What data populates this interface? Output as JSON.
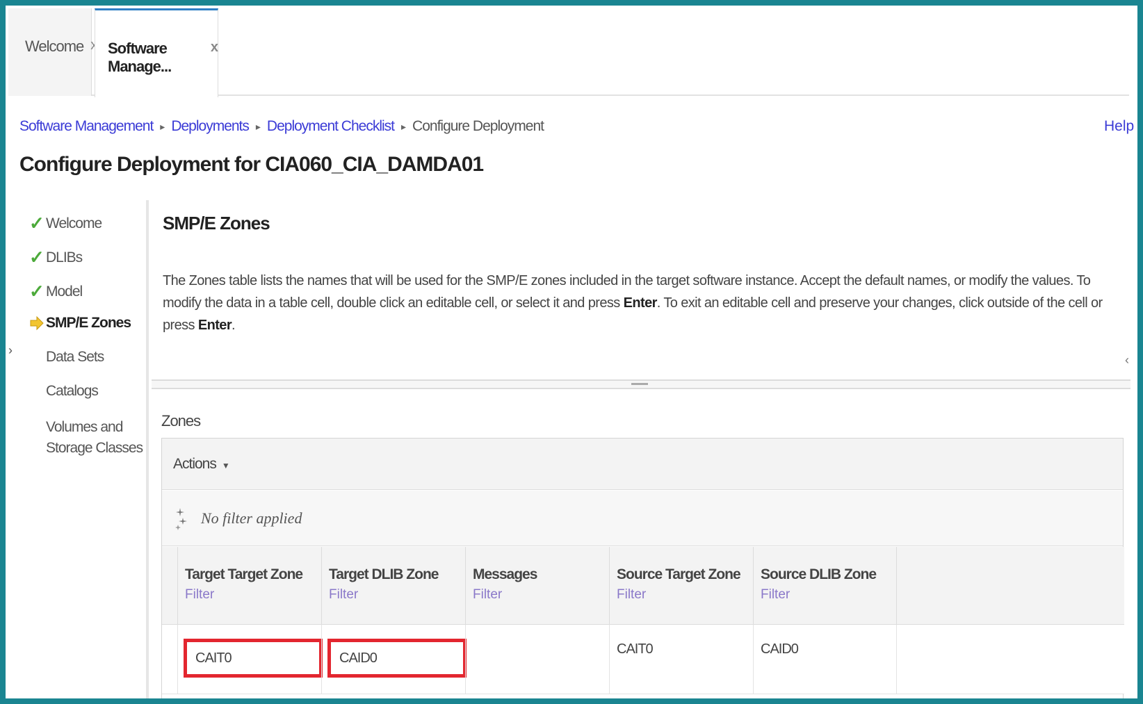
{
  "tabs": [
    {
      "label": "Welcome",
      "close": "x"
    },
    {
      "label": "Software Manage...",
      "close": "x"
    }
  ],
  "breadcrumb": {
    "items": [
      "Software Management",
      "Deployments",
      "Deployment Checklist"
    ],
    "current": "Configure Deployment",
    "separator": "▸"
  },
  "help_label": "Help",
  "page_title": "Configure Deployment for CIA060_CIA_DAMDA01",
  "sidebar": {
    "steps": [
      {
        "label": "Welcome",
        "status": "done"
      },
      {
        "label": "DLIBs",
        "status": "done"
      },
      {
        "label": "Model",
        "status": "done"
      },
      {
        "label": "SMP/E Zones",
        "status": "current"
      },
      {
        "label": "Data Sets",
        "status": "pending"
      },
      {
        "label": "Catalogs",
        "status": "pending"
      },
      {
        "label": "Volumes and Storage Classes",
        "status": "pending"
      }
    ],
    "check_glyph": "✓"
  },
  "main": {
    "section_title": "SMP/E Zones",
    "description_part1": "The Zones table lists the names that will be used for the SMP/E zones included in the target software instance.  Accept the default names, or modify the values. To modify the data in a table cell, double click an editable cell, or select it and press ",
    "description_enter1": "Enter",
    "description_part2": ".  To exit an editable cell and preserve your changes, click outside of the cell or press ",
    "description_enter2": "Enter",
    "description_part3": ".",
    "zones_label": "Zones",
    "actions_label": "Actions",
    "actions_caret": "▼",
    "filter_status": "No filter applied",
    "columns": [
      {
        "label": "Target Target Zone",
        "filter": "Filter"
      },
      {
        "label": "Target DLIB Zone",
        "filter": "Filter"
      },
      {
        "label": "Messages",
        "filter": "Filter"
      },
      {
        "label": "Source Target Zone",
        "filter": "Filter"
      },
      {
        "label": "Source DLIB Zone",
        "filter": "Filter"
      }
    ],
    "rows": [
      {
        "target_target_zone": "CAIT0",
        "target_dlib_zone": "CAID0",
        "messages": "",
        "source_target_zone": "CAIT0",
        "source_dlib_zone": "CAID0"
      }
    ]
  },
  "colors": {
    "frame": "#1a8591",
    "link": "#3b3bd6",
    "highlight_box": "#e3262f",
    "check": "#4caa3a",
    "current_arrow": "#f2c531"
  }
}
